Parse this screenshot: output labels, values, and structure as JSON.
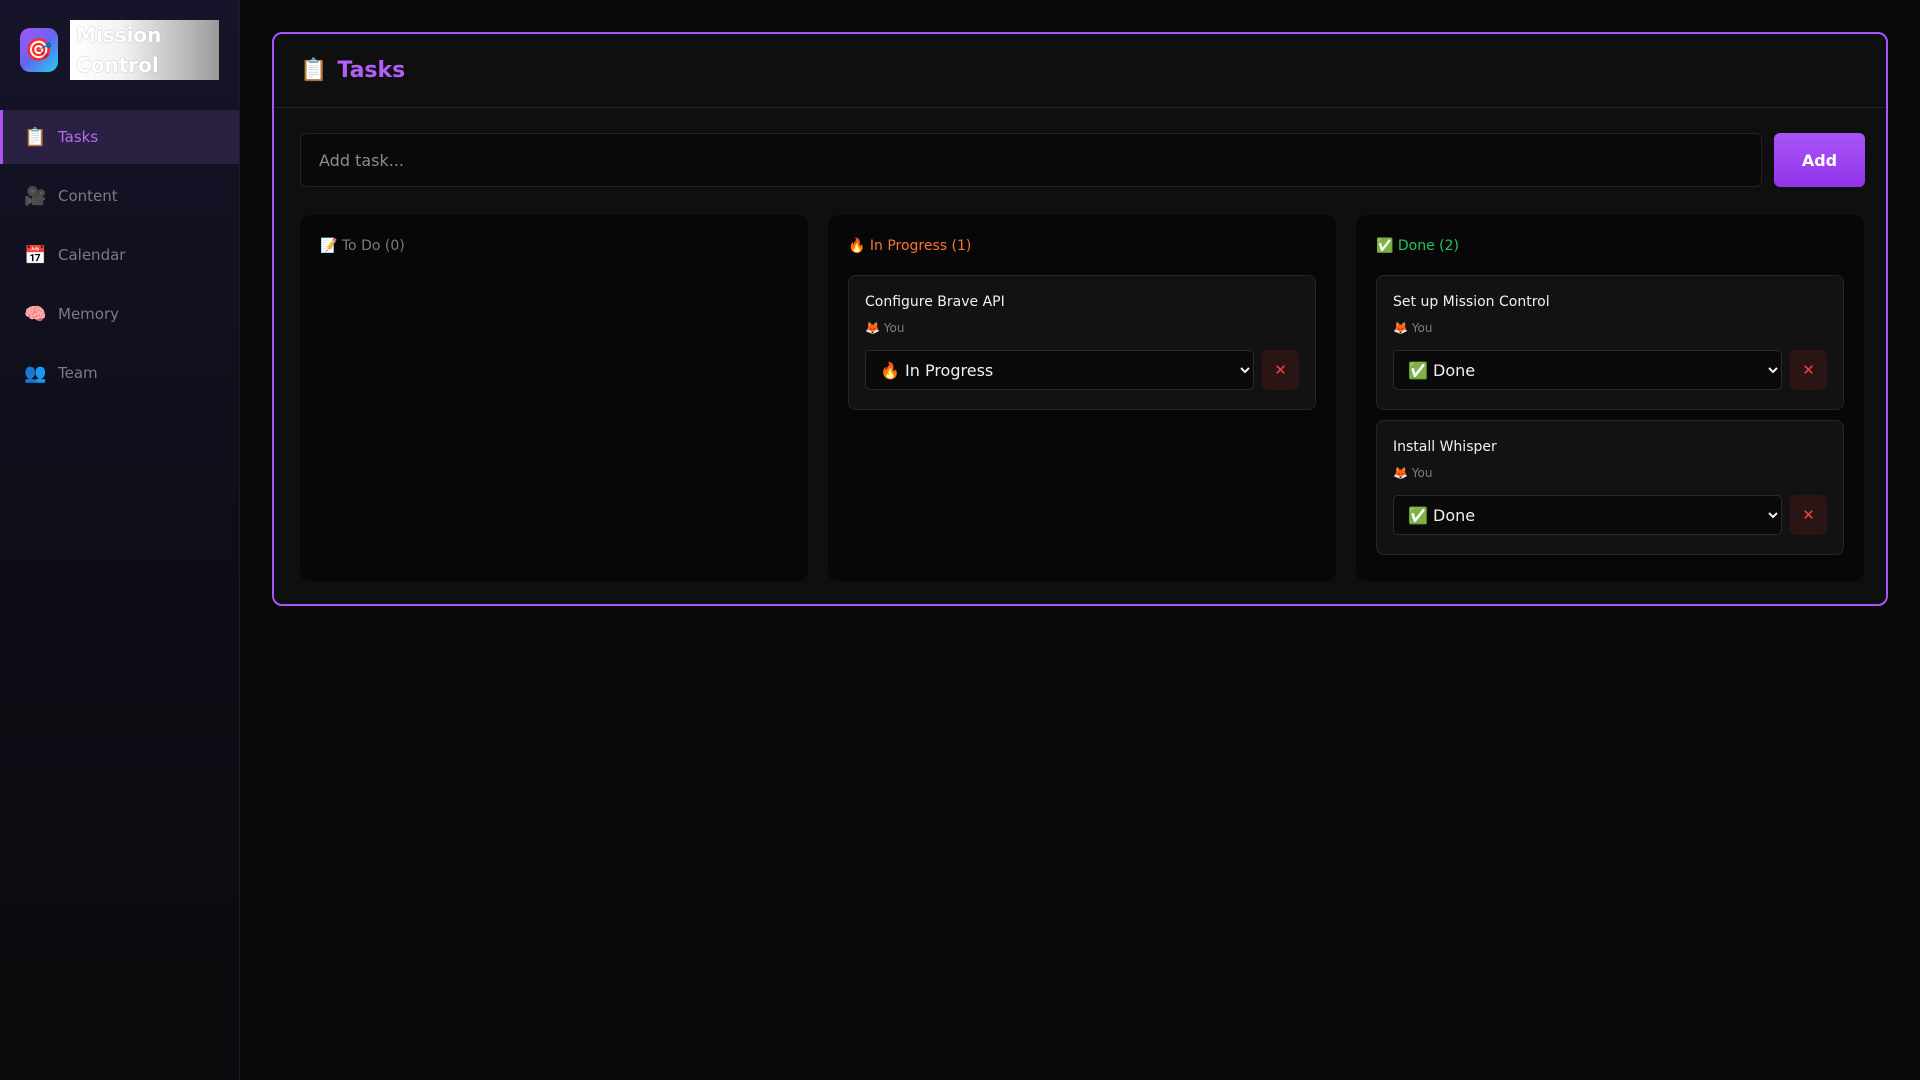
{
  "brand": {
    "logo_icon": "🎯",
    "title": "Mission\nControl"
  },
  "sidebar": {
    "items": [
      {
        "icon": "📋",
        "label": "Tasks",
        "active": true
      },
      {
        "icon": "🎥",
        "label": "Content",
        "active": false
      },
      {
        "icon": "📅",
        "label": "Calendar",
        "active": false
      },
      {
        "icon": "🧠",
        "label": "Memory",
        "active": false
      },
      {
        "icon": "👥",
        "label": "Team",
        "active": false
      }
    ]
  },
  "panel": {
    "title_icon": "📋",
    "title": "Tasks",
    "input_placeholder": "Add task...",
    "add_label": "Add"
  },
  "columns": [
    {
      "header": "📝 To Do (0)",
      "cards": []
    },
    {
      "header": "🔥 In Progress (1)",
      "cards": [
        {
          "title": "Configure Brave API",
          "owner": "🦊 You",
          "status": "🔥 In Progress"
        }
      ]
    },
    {
      "header": "✅ Done (2)",
      "cards": [
        {
          "title": "Set up Mission Control",
          "owner": "🦊 You",
          "status": "✅ Done"
        },
        {
          "title": "Install Whisper",
          "owner": "🦊 You",
          "status": "✅ Done"
        }
      ]
    }
  ],
  "delete_label": "✕",
  "colors": {
    "accent": "#a855f7",
    "in_progress": "#f97338",
    "done": "#22c55e",
    "danger": "#ef4444"
  }
}
